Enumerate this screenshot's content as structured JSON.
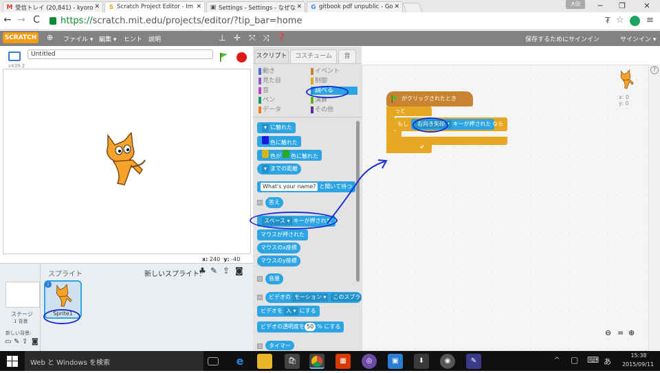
{
  "browser": {
    "tabs": [
      {
        "label": "受信トレイ (20,841) - kyoro",
        "icon": "gmail-icon",
        "active": false
      },
      {
        "label": "Scratch Project Editor - Im",
        "icon": "scratch-icon",
        "active": true
      },
      {
        "label": "Settings - Settings - なぜな",
        "icon": "settings-icon",
        "active": false
      },
      {
        "label": "gitbook pdf unpublic - Go",
        "icon": "google-icon",
        "active": false
      }
    ],
    "user_badge": "大田",
    "url_secure": "https://",
    "url_rest": "scratch.mit.edu/projects/editor/?tip_bar=home"
  },
  "menubar": {
    "logo": "SCRATCH",
    "items": [
      "ファイル ▾",
      "編集 ▾",
      "ヒント",
      "説明"
    ],
    "save_signin": "保存するためにサインイン",
    "signin": "サインイン ▾"
  },
  "stage": {
    "version": "v439.2",
    "title": "Untitled",
    "coords_x_label": "x:",
    "coords_x": "240",
    "coords_y_label": "y:",
    "coords_y": "-40"
  },
  "sprites": {
    "header": "スプライト",
    "new_sprite": "新しいスプライト:",
    "stage_label": "ステージ",
    "stage_backdrops": "1 背景",
    "new_backdrop": "新しい背景:",
    "sprite1_name": "Sprite1"
  },
  "palette": {
    "tabs": [
      "スクリプト",
      "コスチューム",
      "音"
    ],
    "categories_left": [
      {
        "label": "動き",
        "color": "#4a6cd4"
      },
      {
        "label": "見た目",
        "color": "#8a55d7"
      },
      {
        "label": "音",
        "color": "#bb42c3"
      },
      {
        "label": "ペン",
        "color": "#0e9a6c"
      },
      {
        "label": "データ",
        "color": "#ee7d16"
      }
    ],
    "categories_right": [
      {
        "label": "イベント",
        "color": "#c88330"
      },
      {
        "label": "制御",
        "color": "#e1a91a"
      },
      {
        "label": "調べる",
        "color": "#2ca5e2"
      },
      {
        "label": "演算",
        "color": "#5cb712"
      },
      {
        "label": "その他",
        "color": "#632d99"
      }
    ],
    "blocks": {
      "touching": "に触れた",
      "color_touching": "色に触れた",
      "color_is_touching_a": "色が",
      "color_is_touching_b": "色に触れた",
      "distance_to": "までの距離",
      "ask_default": "What's your name?",
      "ask_suffix": "と聞いて待つ",
      "answer": "答え",
      "key_space": "スペース",
      "key_pressed": "キーが押された",
      "mouse_down": "マウスが押された",
      "mouse_x": "マウスのx座標",
      "mouse_y": "マウスのy座標",
      "loudness": "音量",
      "video_prefix": "ビデオの",
      "video_motion": "モーション",
      "video_on": "このスプライト",
      "video_turn": "ビデオを",
      "video_state": "入",
      "video_turn_suffix": "にする",
      "video_transp": "ビデオの透明度を",
      "video_transp_val": "50",
      "video_transp_suffix": "% にする",
      "timer": "タイマー"
    }
  },
  "script": {
    "hat": "がクリックされたとき",
    "forever": "ずっと",
    "if": "もし",
    "key": "右向き矢印",
    "key_pressed": "キーが押された",
    "then": "なら",
    "sprite_x": "x: 0",
    "sprite_y": "y: 0"
  },
  "taskbar": {
    "search": "Web と Windows を検索",
    "time": "15:38",
    "date": "2015/09/11",
    "ime": "あ"
  }
}
